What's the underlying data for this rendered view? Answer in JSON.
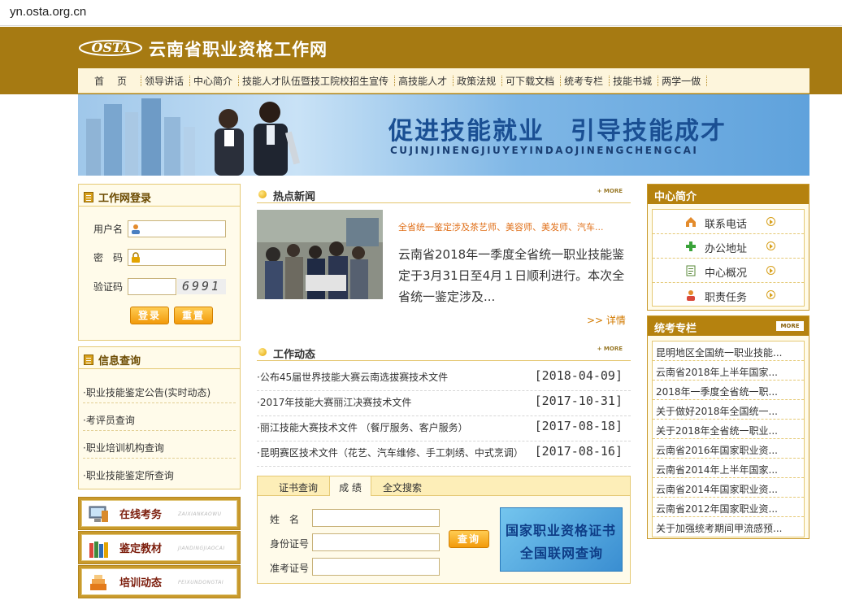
{
  "browser": {
    "url": "yn.osta.org.cn"
  },
  "header": {
    "logo_text": "OSTA",
    "site_title": "云南省职业资格工作网"
  },
  "nav": {
    "items": [
      "首页",
      "领导讲话",
      "中心简介",
      "技能人才队伍暨技工院校招生宣传",
      "高技能人才",
      "政策法规",
      "可下载文档",
      "统考专栏",
      "技能书城",
      "两学一做"
    ]
  },
  "banner": {
    "slogan": "促进技能就业　引导技能成才",
    "pinyin": "CUJINJINENGJIUYEYINDAOJINENGCHENGCAI"
  },
  "login": {
    "title": "工作网登录",
    "username_label": "用户名",
    "password_label": "密　码",
    "captcha_label": "验证码",
    "captcha_value": "6991",
    "login_button": "登录",
    "reset_button": "重置"
  },
  "info_query": {
    "title": "信息查询",
    "items": [
      "·职业技能鉴定公告(实时动态)",
      "·考评员查询",
      "·职业培训机构查询",
      "·职业技能鉴定所查询"
    ]
  },
  "tiles": [
    {
      "title": "在线考务",
      "pinyin": "ZAIXIANKAOWU"
    },
    {
      "title": "鉴定教材",
      "pinyin": "JIANDINGJIAOCAI"
    },
    {
      "title": "培训动态",
      "pinyin": "PEIXUNDONGTAI"
    }
  ],
  "hot_news": {
    "title": "热点新闻",
    "more": "+ MORE",
    "headline": "全省统一鉴定涉及茶艺师、美容师、美发师、汽车...",
    "body": "云南省2018年一季度全省统一职业技能鉴定于3月31日至4月１日顺利进行。本次全省统一鉴定涉及...",
    "detail_link": ">> 详情"
  },
  "work_news": {
    "title": "工作动态",
    "more": "+ MORE",
    "items": [
      {
        "title": "·公布45届世界技能大赛云南选拔赛技术文件",
        "date": "[2018-04-09]"
      },
      {
        "title": "·2017年技能大赛丽江决赛技术文件",
        "date": "[2017-10-31]"
      },
      {
        "title": "·丽江技能大赛技术文件 （餐厅服务、客户服务）",
        "date": "[2017-08-18]"
      },
      {
        "title": "·昆明赛区技术文件（花艺、汽车维修、手工刺绣、中式烹调）",
        "date": "[2017-08-16]"
      }
    ]
  },
  "query_form": {
    "tabs": [
      "证书查询",
      "成 绩",
      "全文搜索"
    ],
    "name_label": "姓　名",
    "id_label": "身份证号",
    "ticket_label": "准考证号",
    "search_button": "查询",
    "cert_banner_line1": "国家职业资格证书",
    "cert_banner_line2": "全国联网查询"
  },
  "center_intro": {
    "title": "中心简介",
    "items": [
      "联系电话",
      "办公地址",
      "中心概况",
      "职责任务"
    ]
  },
  "exam_column": {
    "title": "统考专栏",
    "more": "MORE",
    "items": [
      "昆明地区全国统一职业技能...",
      "云南省2018年上半年国家...",
      "2018年一季度全省统一职...",
      "关于做好2018年全国统一...",
      "关于2018年全省统一职业...",
      "云南省2016年国家职业资...",
      "云南省2014年上半年国家...",
      "云南省2014年国家职业资...",
      "云南省2012年国家职业资...",
      "关于加强统考期间甲流感预..."
    ]
  },
  "colors": {
    "brand_gold": "#a67a12",
    "panel_bg": "#fffbea",
    "accent_orange": "#f29a0b",
    "headline_orange": "#e0701a"
  }
}
